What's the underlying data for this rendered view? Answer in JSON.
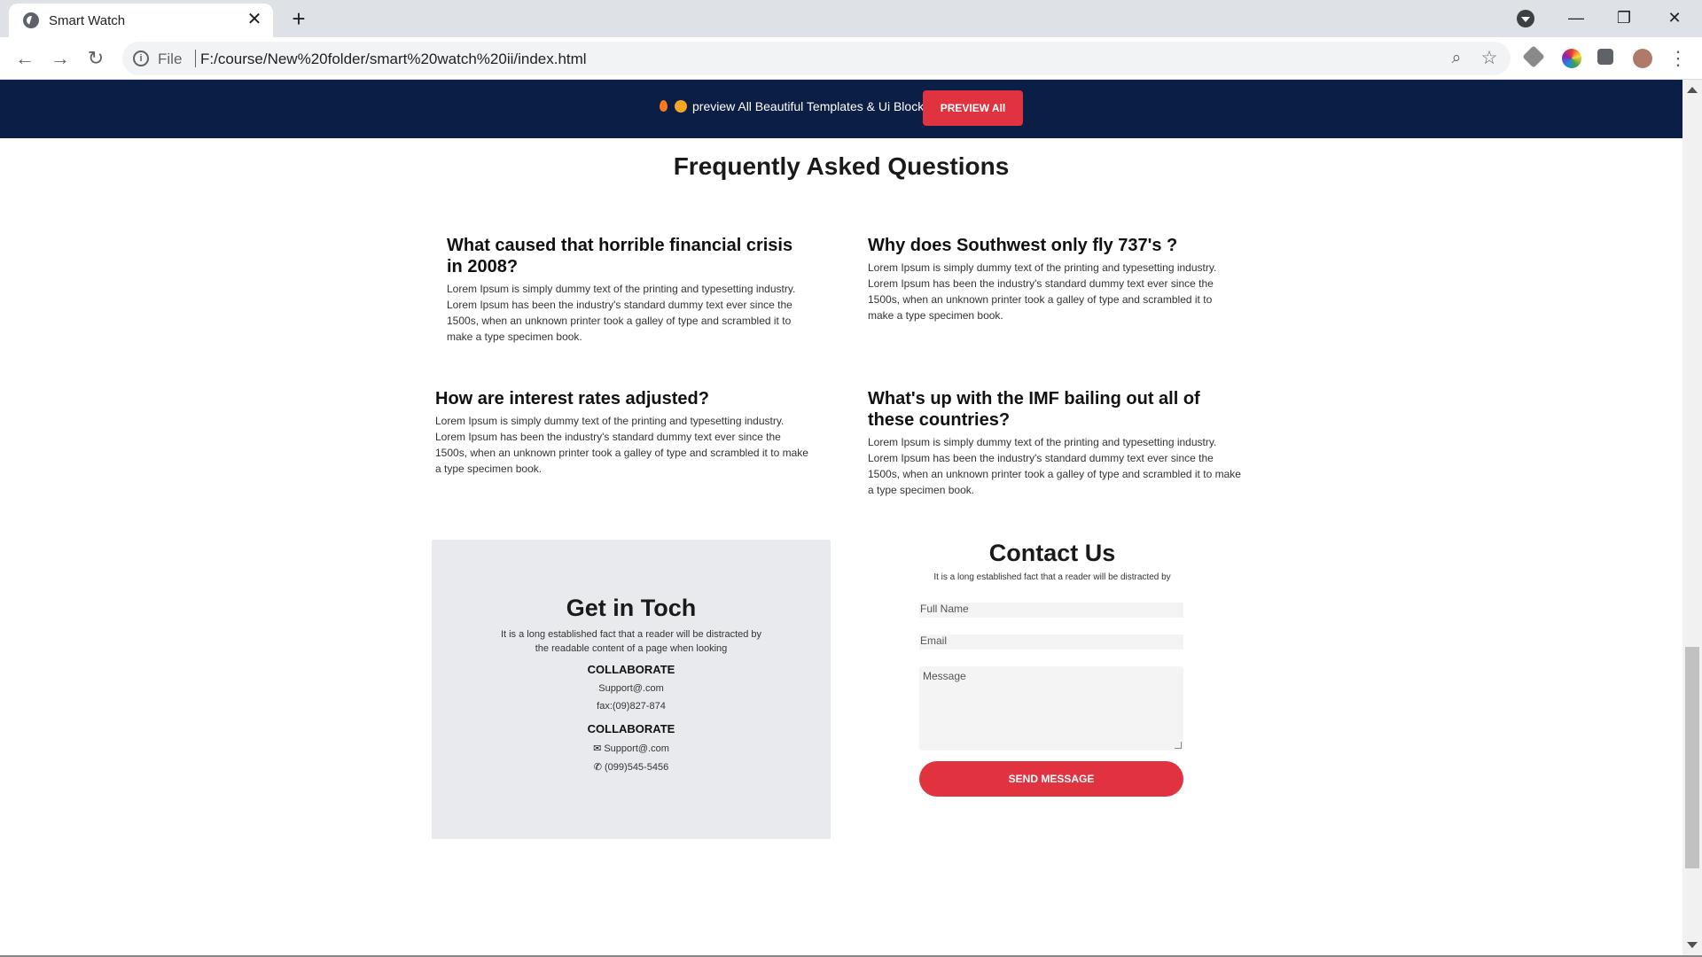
{
  "browser": {
    "tab_title": "Smart Watch",
    "url_scheme_label": "File",
    "url": "F:/course/New%20folder/smart%20watch%20ii/index.html"
  },
  "promo": {
    "text": "preview All Beautiful Templates & Ui Blocks",
    "button": "PREVIEW All"
  },
  "faq": {
    "title": "Frequently Asked Questions",
    "items": [
      {
        "question": "What caused that horrible financial crisis in 2008?",
        "answer": "Lorem Ipsum is simply dummy text of the printing and typesetting industry. Lorem Ipsum has been the industry's standard dummy text ever since the 1500s, when an unknown printer took a galley of type and scrambled it to make a type specimen book."
      },
      {
        "question": "Why does Southwest only fly 737's ?",
        "answer": "Lorem Ipsum is simply dummy text of the printing and typesetting industry. Lorem Ipsum has been the industry's standard dummy text ever since the 1500s, when an unknown printer took a galley of type and scrambled it to make a type specimen book."
      },
      {
        "question": "How are interest rates adjusted?",
        "answer": "Lorem Ipsum is simply dummy text of the printing and typesetting industry. Lorem Ipsum has been the industry's standard dummy text ever since the 1500s, when an unknown printer took a galley of type and scrambled it to make a type specimen book."
      },
      {
        "question": "What's up with the IMF bailing out all of these countries?",
        "answer": "Lorem Ipsum is simply dummy text of the printing and typesetting industry. Lorem Ipsum has been the industry's standard dummy text ever since the 1500s, when an unknown printer took a galley of type and scrambled it to make a type specimen book."
      }
    ]
  },
  "get_in_touch": {
    "title": "Get in Toch",
    "subtitle": "It is a long established fact that a reader will be distracted by the readable content of a page when looking",
    "block1_heading": "COLLABORATE",
    "block1_email": "Support@.com",
    "block1_fax": "fax:(09)827-874",
    "block2_heading": "COLLABORATE",
    "block2_email": "Support@.com",
    "block2_phone": "(099)545-5456"
  },
  "contact": {
    "title": "Contact Us",
    "subtitle": "It is a long established fact that a reader will be distracted by",
    "name_placeholder": "Full Name",
    "email_placeholder": "Email",
    "message_placeholder": "Message",
    "send_button": "SEND MESSAGE"
  },
  "colors": {
    "promo_bg": "#0b1e46",
    "accent": "#e0323f",
    "card_bg": "#e8eaed"
  },
  "icons": [
    "globe-icon",
    "close-icon",
    "plus-icon",
    "back-arrow-icon",
    "forward-arrow-icon",
    "reload-icon",
    "info-icon",
    "zoom-icon",
    "star-icon",
    "puzzle-icon",
    "envelope-icon",
    "phone-icon"
  ]
}
